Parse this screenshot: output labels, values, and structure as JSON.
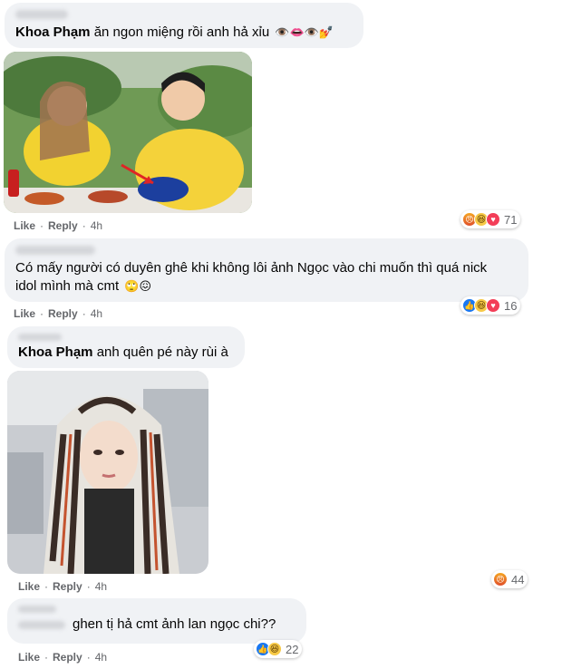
{
  "comments": [
    {
      "mention": "Khoa Phạm",
      "text": "ăn ngon miệng rồi anh hả xỉu",
      "emojis": "👁️👄👁️💅",
      "actions": {
        "like": "Like",
        "reply": "Reply",
        "time": "4h"
      },
      "reactions": {
        "icons": [
          "angry-icon",
          "haha-icon",
          "love-icon"
        ],
        "count": "71"
      }
    },
    {
      "text": "Có mấy người có duyên ghê khi không lôi ảnh Ngọc vào chi muốn thì quá nick idol mình mà cmt",
      "emojis": "🙄😖",
      "actions": {
        "like": "Like",
        "reply": "Reply",
        "time": "4h"
      },
      "reactions": {
        "icons": [
          "like-icon",
          "haha-icon",
          "love-icon"
        ],
        "count": "16"
      }
    },
    {
      "mention": "Khoa Phạm",
      "text": "anh quên pé này rùi à",
      "actions": {
        "like": "Like",
        "reply": "Reply",
        "time": "4h"
      },
      "reactions": {
        "icons": [
          "angry-icon"
        ],
        "count": "44"
      }
    },
    {
      "text": "ghen tị hả cmt ảnh lan ngọc chi??",
      "actions": {
        "like": "Like",
        "reply": "Reply",
        "time": "4h"
      },
      "reactions": {
        "icons": [
          "like-icon",
          "haha-icon"
        ],
        "count": "22"
      }
    }
  ],
  "colors": {
    "bubble": "#f0f2f5",
    "meta": "#65676b",
    "like_blue": "#1877f2",
    "love_red": "#f33e58"
  }
}
